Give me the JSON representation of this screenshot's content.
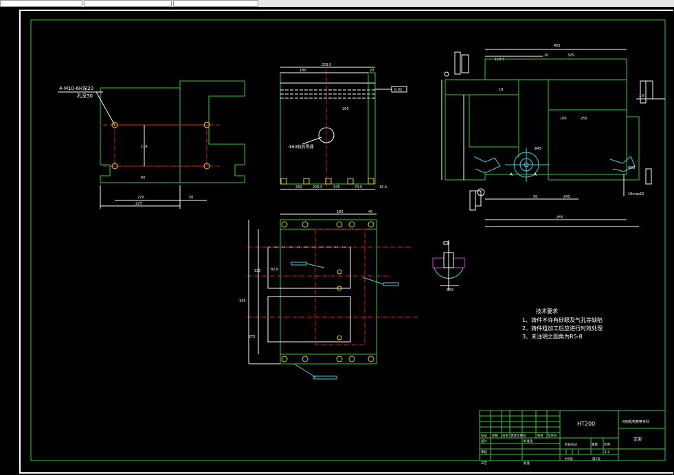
{
  "notes": {
    "title": "技术要求",
    "items": [
      "1、铸件不许有砂眼及气孔等缺陷",
      "2、铸件粗加工后应进行时效处理",
      "3、未注明之圆角为R5-8"
    ]
  },
  "callouts": {
    "thread_spec_line1": "4-M10-6H深20",
    "thread_spec_line2": "孔深30",
    "bore_note": "Φ60前后贯通"
  },
  "title_block": {
    "material": "HT200",
    "school": "河南机电高等专科",
    "part_name": "支架",
    "scale": "1:2",
    "header_row": [
      "标记",
      "处数",
      "分区",
      "更改文件号",
      "签名",
      "年月日"
    ],
    "designer": "设计",
    "standardize": "标准化",
    "review": "审核",
    "process": "工艺",
    "approve": "批准",
    "stage_mark": "阶段标记",
    "weight": "重量",
    "ratio": "比例",
    "sheets_total": "共1张",
    "sheet_no": "第1张"
  },
  "dims": {
    "front_width": "225",
    "front_hole_span": "220",
    "front_offset": "50",
    "front_height": "118",
    "front_small": "60",
    "top_total": "229.5",
    "top_180": "180",
    "top_20": "20",
    "top_100": "100",
    "top_bottom_1": "250",
    "top_bottom_2": "229.5",
    "top_bottom_3": "145",
    "top_bottom_4": "74.5",
    "top_bottom_5": "15.5",
    "tol_box": "0.02",
    "right_total": "455",
    "right_325": "325",
    "right_20": "20",
    "right_118_5": "118.5",
    "right_100": "100",
    "right_255": "255",
    "right_245": "245",
    "right_50": "50",
    "right_460": "455",
    "right_phi45": "Φ45",
    "right_1_6": "1.6",
    "right_19": "19",
    "right_phi30": "Φ30",
    "right_10_max": "10max15",
    "right_A": "A",
    "bottom_160": "160",
    "bottom_40": "40",
    "bottom_325": "325",
    "bottom_345": "345",
    "bottom_275": "275",
    "bottom_82_6": "82.6",
    "detail_phi55": "Φ55"
  }
}
